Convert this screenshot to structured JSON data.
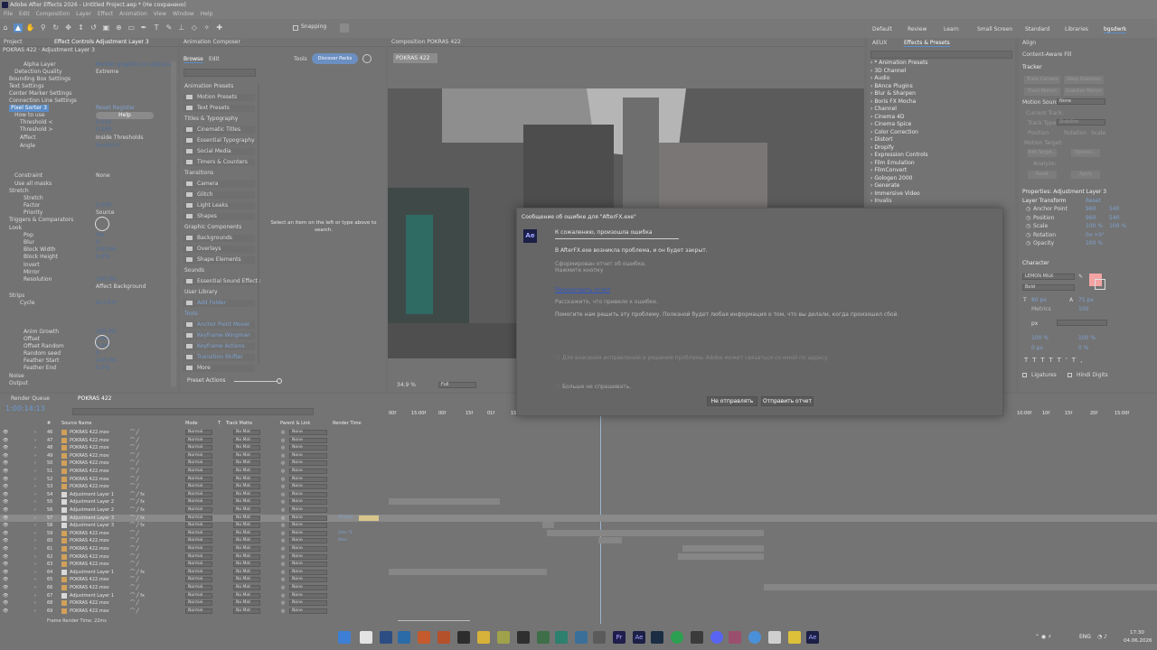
{
  "app": {
    "title": "Adobe After Effects 2026 - Untitled Project.aep * (Не сохранено)"
  },
  "menu": [
    "File",
    "Edit",
    "Composition",
    "Layer",
    "Effect",
    "Animation",
    "View",
    "Window",
    "Help"
  ],
  "toolbar": {
    "snapping": "Snapping"
  },
  "workspaces": [
    "Default",
    "Review",
    "Learn",
    "Small Screen",
    "Standard",
    "Libraries",
    "bgsdwrk"
  ],
  "left_panel": {
    "project_tab": "Project",
    "effect_tab": "Effect Controls Adjustment Layer 3",
    "layer_path": "POKRAS 422 · Adjustment Layer 3",
    "rows": [
      {
        "label": "Alpha Layer",
        "value": "Render graphics on alpha la"
      },
      {
        "label": "Detection Quality",
        "value": "Extreme"
      },
      {
        "label": "Bounding Box Settings",
        "value": ""
      },
      {
        "label": "Text Settings",
        "value": ""
      },
      {
        "label": "Center Marker Settings",
        "value": ""
      },
      {
        "label": "Connection Line Settings",
        "value": ""
      },
      {
        "label": "Pixel Sorter 3",
        "value": "Reset   Register"
      },
      {
        "label": "How to use",
        "value": "Help"
      },
      {
        "label": "Threshold <",
        "value": "0.010"
      },
      {
        "label": "Threshold >",
        "value": "0.500"
      },
      {
        "label": "Affect",
        "value": "Inside Thresholds"
      },
      {
        "label": "Angle",
        "value": "0x+90.0°"
      },
      {
        "label": "Constraint",
        "value": "None"
      },
      {
        "label": "Use all masks",
        "value": ""
      },
      {
        "label": "Stretch",
        "value": ""
      },
      {
        "label": "Stretch",
        "value": ""
      },
      {
        "label": "Factor",
        "value": "2.000"
      },
      {
        "label": "Priority",
        "value": "Source"
      },
      {
        "label": "Triggers & Comparators",
        "value": ""
      },
      {
        "label": "Look",
        "value": ""
      },
      {
        "label": "Pop",
        "value": "0%"
      },
      {
        "label": "Blur",
        "value": "0"
      },
      {
        "label": "Block Width",
        "value": "100.0%"
      },
      {
        "label": "Block Height",
        "value": "0.0%"
      },
      {
        "label": "Invert",
        "value": ""
      },
      {
        "label": "Mirror",
        "value": ""
      },
      {
        "label": "Resolution",
        "value": "100.0%"
      },
      {
        "label": "",
        "value": "Affect Background"
      },
      {
        "label": "Strips",
        "value": ""
      },
      {
        "label": "Cycle",
        "value": "0x+0.0°"
      },
      {
        "label": "Anim Growth",
        "value": "100.0%"
      },
      {
        "label": "Offset",
        "value": "0.0%"
      },
      {
        "label": "Offset Random",
        "value": "0.0%"
      },
      {
        "label": "Random seed",
        "value": "0"
      },
      {
        "label": "Feather Start",
        "value": "100.0%"
      },
      {
        "label": "Feather End",
        "value": "0.0%"
      },
      {
        "label": "Noise",
        "value": ""
      },
      {
        "label": "Output",
        "value": ""
      }
    ]
  },
  "composer": {
    "title": "Animation Composer",
    "tabs": [
      "Browse",
      "Edit"
    ],
    "tools": "Tools",
    "discover": "Discover Packs",
    "items": [
      "Animation Presets",
      "Motion Presets",
      "Text Presets",
      "Titles & Typography",
      "Cinematic Titles",
      "Essential Typography",
      "Social Media",
      "Timers & Counters",
      "Transitions",
      "Camera",
      "Glitch",
      "Light Leaks",
      "Shapes",
      "Graphic Components",
      "Backgrounds",
      "Overlays",
      "Shape Elements",
      "Sounds",
      "Essential Sound Effects",
      "User Library",
      "Add Folder",
      "Tools",
      "Anchor Point Mover",
      "Keyframe Wingman",
      "Keyframe Actions",
      "Transition Shifter",
      "More"
    ],
    "hint": "Select an item on the left or type above to search.",
    "preset_actions": "Preset Actions"
  },
  "composition": {
    "tab": "Composition POKRAS 422",
    "subtab": "POKRAS 422",
    "zoom": "34.9 %",
    "res": "Full"
  },
  "effects_presets": {
    "tabs": [
      "AEUX",
      "Effects & Presets"
    ],
    "items": [
      "* Animation Presets",
      "3D Channel",
      "Audio",
      "BAnce Plugins",
      "Blur & Sharpen",
      "Boris FX Mocha",
      "Channel",
      "Cinema 4D",
      "Cinema Spice",
      "Color Correction",
      "Distort",
      "Dropify",
      "Expression Controls",
      "Film Emulation",
      "FilmConvert",
      "Gologen 2000",
      "Generate",
      "Immersive Video",
      "Invalis"
    ]
  },
  "right_panel": {
    "tabs": [
      "Align",
      "Content-Aware Fill"
    ],
    "tracker": "Tracker",
    "tracker_buttons": [
      "Track Camera",
      "Warp Stabilizer",
      "Track Motion",
      "Stabilize Motion"
    ],
    "motion_source": "Motion Source:",
    "motion_source_val": "None",
    "current_track": "Current Track:",
    "track_type": "Track Type:",
    "track_type_val": "Stabilize",
    "options": [
      "Position",
      "Rotation",
      "Scale"
    ],
    "motion_target": "Motion Target:",
    "edit_target": "Edit Target...",
    "options_btn": "Options...",
    "analyze": "Analyze:",
    "reset": "Reset",
    "apply": "Apply",
    "properties": "Properties: Adjustment Layer 3",
    "layer_transform": "Layer Transform",
    "reset_link": "Reset",
    "props": [
      {
        "label": "Anchor Point",
        "v1": "960",
        "v2": "540"
      },
      {
        "label": "Position",
        "v1": "960",
        "v2": "540"
      },
      {
        "label": "Scale",
        "v1": "100 %",
        "v2": "100 %"
      },
      {
        "label": "Rotation",
        "v1": "0x +0°",
        "v2": ""
      },
      {
        "label": "Opacity",
        "v1": "100 %",
        "v2": ""
      }
    ],
    "character": "Character",
    "font": "LEMON MILK",
    "style": "Bold",
    "size": "80 px",
    "leading": "75 px",
    "metrics": "Metrics",
    "tracking": "100",
    "px": "px",
    "scale_v": "100 %",
    "scale_h": "100 %",
    "baseline": "0 px",
    "tsume": "0 %",
    "ligatures": "Ligatures",
    "hindi": "Hindi Digits"
  },
  "dialog": {
    "title": "Сообщение об ошибке для \"AfterFX.exe\"",
    "heading": "К сожалению, произошла ошибка",
    "line1": "В AfterFX.exe возникла проблема, и он будет закрыт.",
    "line2": "Сформирован отчет об ошибке.",
    "line3": "Нажмите кнопку",
    "view_report": "Просмотреть отчет",
    "line4": "Расскажите, что привело к ошибке.",
    "line5": "Помогите нам решить эту проблему. Полезной будет любая информация о том, что вы делали, когда произошел сбой.",
    "contact": "Для внесения исправлений и решения проблемы Adobe может связаться со мной по адресу",
    "dont_ask": "Больше не спрашивать.",
    "dont_send": "Не отправлять",
    "send": "Отправить отчет"
  },
  "timeline": {
    "tabs": [
      "Render Queue",
      "POKRAS 422"
    ],
    "timecode": "1:00:14:13",
    "headers": [
      "#",
      "Source Name",
      "Mode",
      "T",
      "Track Matte",
      "Parent & Link",
      "Render Time"
    ],
    "ruler": [
      "00f",
      "15:00f",
      "00f",
      "15f",
      "01f",
      "15f",
      "02f",
      "10:00f",
      "10f",
      "15f",
      "20f",
      "15:00f"
    ],
    "footer": "Frame Render Time: 22ms",
    "layers": [
      {
        "n": "46",
        "name": "POKRAS 422.mov",
        "kind": "v"
      },
      {
        "n": "47",
        "name": "POKRAS 422.mov",
        "kind": "v"
      },
      {
        "n": "48",
        "name": "POKRAS 422.mov",
        "kind": "v"
      },
      {
        "n": "49",
        "name": "POKRAS 422.mov",
        "kind": "v"
      },
      {
        "n": "50",
        "name": "POKRAS 422.mov",
        "kind": "v"
      },
      {
        "n": "51",
        "name": "POKRAS 422.mov",
        "kind": "v"
      },
      {
        "n": "52",
        "name": "POKRAS 422.mov",
        "kind": "v"
      },
      {
        "n": "53",
        "name": "POKRAS 422.mov",
        "kind": "v"
      },
      {
        "n": "54",
        "name": "Adjustment Layer 1",
        "kind": "a"
      },
      {
        "n": "55",
        "name": "Adjustment Layer 2",
        "kind": "a"
      },
      {
        "n": "56",
        "name": "Adjustment Layer 2",
        "kind": "a"
      },
      {
        "n": "57",
        "name": "Adjustment Layer 3",
        "kind": "a",
        "sel": true,
        "rt": "22.0ms"
      },
      {
        "n": "58",
        "name": "Adjustment Layer 3",
        "kind": "a"
      },
      {
        "n": "59",
        "name": "POKRAS 422.mov",
        "kind": "v",
        "rt": "0ms *1"
      },
      {
        "n": "60",
        "name": "POKRAS 422.mov",
        "kind": "v",
        "rt": "0ms"
      },
      {
        "n": "61",
        "name": "POKRAS 422.mov",
        "kind": "v"
      },
      {
        "n": "62",
        "name": "POKRAS 422.mov",
        "kind": "v"
      },
      {
        "n": "63",
        "name": "POKRAS 422.mov",
        "kind": "v"
      },
      {
        "n": "64",
        "name": "Adjustment Layer 1",
        "kind": "a"
      },
      {
        "n": "65",
        "name": "POKRAS 422.mov",
        "kind": "v"
      },
      {
        "n": "66",
        "name": "POKRAS 422.mov",
        "kind": "v"
      },
      {
        "n": "67",
        "name": "Adjustment Layer 1",
        "kind": "a"
      },
      {
        "n": "68",
        "name": "POKRAS 422.mov",
        "kind": "v"
      },
      {
        "n": "69",
        "name": "POKRAS 422.mov",
        "kind": "v"
      }
    ],
    "mode": "Normal",
    "matte": "No Mat",
    "parent": "None"
  },
  "taskbar": {
    "lang": "ENG",
    "time": "17:30",
    "date": "04.06.2026"
  }
}
